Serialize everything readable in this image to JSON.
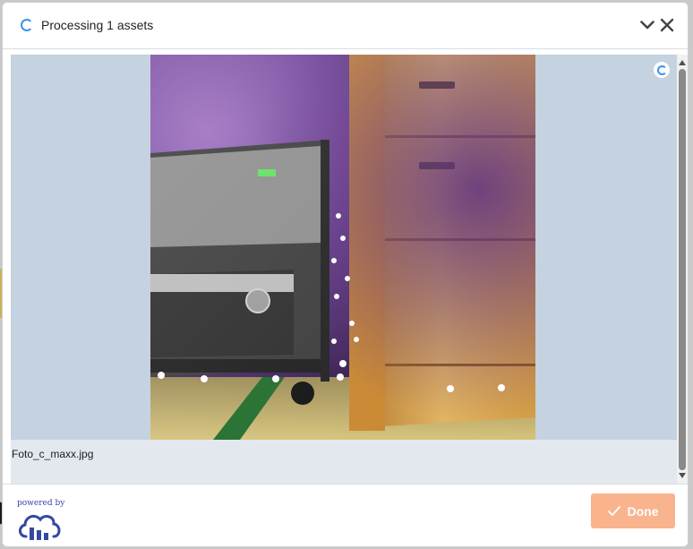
{
  "header": {
    "title": "Processing 1 assets",
    "spinner_icon": "loading-spinner-icon",
    "collapse_icon": "chevron-down-icon",
    "close_icon": "close-icon"
  },
  "assets": [
    {
      "filename": "Foto_c_maxx.jpg",
      "status_icon": "processing-icon"
    }
  ],
  "footer": {
    "powered_by": "powered by",
    "logo_icon": "cloudinary-logo-icon",
    "done_label": "Done",
    "done_icon": "checkmark-icon",
    "done_enabled": false
  },
  "colors": {
    "accent_blue": "#3a93f0",
    "done_button": "#f9b48d",
    "brand_blue": "#3448a4",
    "thumb_background": "#c5d2df"
  }
}
